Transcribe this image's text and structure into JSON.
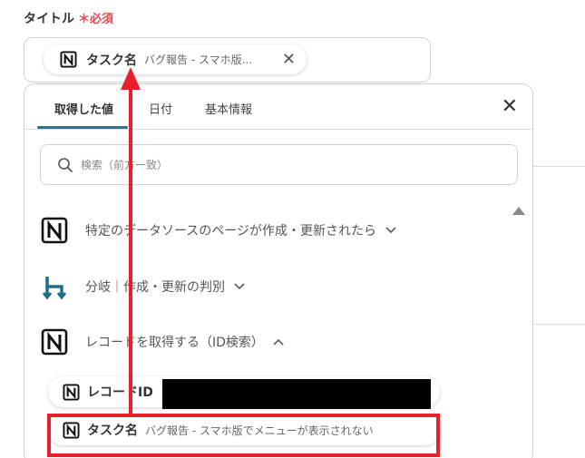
{
  "field": {
    "label": "タイトル",
    "required_mark": "＊必須"
  },
  "selected_chip": {
    "icon": "notion-icon",
    "name": "タスク名",
    "value": "バグ報告 - スマホ版...",
    "remove": "✕"
  },
  "panel": {
    "tabs": [
      "取得した値",
      "日付",
      "基本情報"
    ],
    "active_tab": "取得した値",
    "close": "✕",
    "search_placeholder": "検索（前方一致）",
    "steps": [
      {
        "icon": "notion-icon",
        "label": "特定のデータソースのページが作成・更新されたら",
        "expanded": false
      },
      {
        "icon": "branch-icon",
        "label": "分岐｜作成・更新の判別",
        "expanded": false
      },
      {
        "icon": "notion-icon",
        "label": "レコードを取得する（ID検索）",
        "expanded": true
      }
    ],
    "record_id": {
      "icon": "notion-icon",
      "name": "レコードID"
    },
    "task_name": {
      "icon": "notion-icon",
      "name": "タスク名",
      "value": "バグ報告 - スマホ版でメニューが表示されない"
    }
  },
  "colors": {
    "accent": "#1d7c8a",
    "required": "#e24a56",
    "highlight": "#e8202a"
  }
}
